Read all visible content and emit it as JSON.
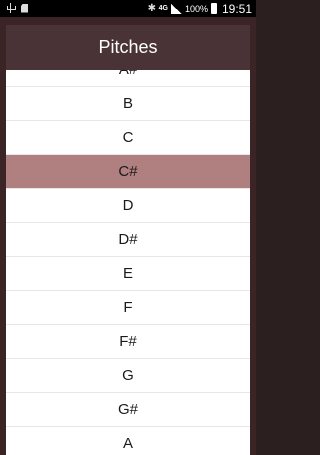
{
  "status_bar": {
    "network": "4G",
    "battery": "100%",
    "time": "19:51"
  },
  "dialog": {
    "title": "Pitches",
    "items": [
      "A#",
      "B",
      "C",
      "C#",
      "D",
      "D#",
      "E",
      "F",
      "F#",
      "G",
      "G#",
      "A"
    ],
    "selected": "C#"
  },
  "colors": {
    "header": "#4a3336",
    "selected_row": "#b07f80",
    "backdrop": "#3a2426"
  }
}
